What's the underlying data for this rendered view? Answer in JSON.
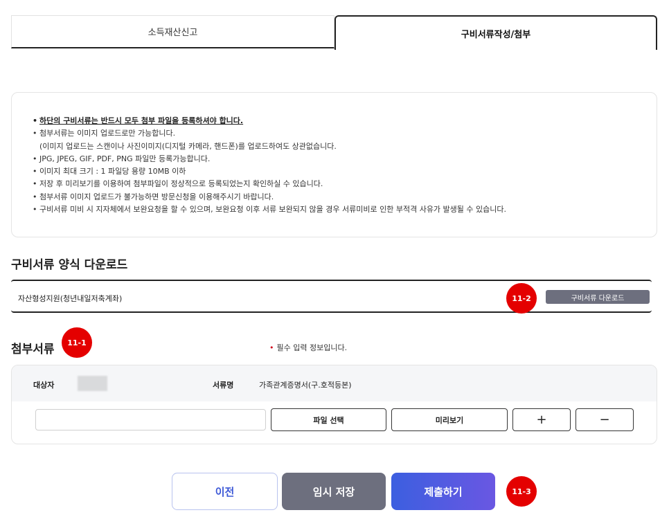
{
  "tabs": [
    {
      "label": "소득재산신고",
      "active": false
    },
    {
      "label": "구비서류작성/첨부",
      "active": true
    }
  ],
  "notice": {
    "bullet": "•",
    "items": [
      "하단의 구비서류는 반드시 모두 첨부 파일을 등록하셔야 합니다.",
      "첨부서류는 이미지 업로드로만 가능합니다.",
      "(이미지 업로드는 스캔이나 사진이미지(디지털 카메라, 핸드폰)를 업로드하여도 상관없습니다.",
      "JPG, JPEG, GIF, PDF, PNG 파일만 등록가능합니다.",
      "이미지 최대 크기 : 1 파일당 용량 10MB 이하",
      "저장 후 미리보기를 이용하여 첨부파일이 정상적으로 등록되었는지 확인하실 수 있습니다.",
      "첨부서류 이미지 업로드가 불가능하면 방문신청을 이용해주시기 바랍니다.",
      "구비서류 미비 시 지자체에서 보완요청을 할 수 있으며, 보완요청 이후 서류 보완되지 않을 경우 서류미비로 인한 부적격 사유가 발생될 수 있습니다."
    ]
  },
  "download": {
    "title": "구비서류 양식 다운로드",
    "row_name": "자산형성지원(청년내일저축계좌)",
    "button": "구비서류 다운로드"
  },
  "attach": {
    "title": "첨부서류",
    "required_mark": "•",
    "required_text": "필수 입력 정보입니다.",
    "target_label": "대상자",
    "doc_label": "서류명",
    "doc_value": "가족관계증명서(구.호적등본)",
    "file_input_value": "",
    "select_button": "파일 선택",
    "preview_button": "미리보기",
    "add_button": "+",
    "remove_button": "−"
  },
  "badges": {
    "b1": "11-1",
    "b2": "11-2",
    "b3": "11-3"
  },
  "footer": {
    "prev": "이전",
    "temp_save": "임시 저장",
    "submit": "제출하기"
  },
  "colors": {
    "accent": "#3b57d6",
    "badge": "#e40000",
    "gray_button": "#6d6f7e"
  }
}
